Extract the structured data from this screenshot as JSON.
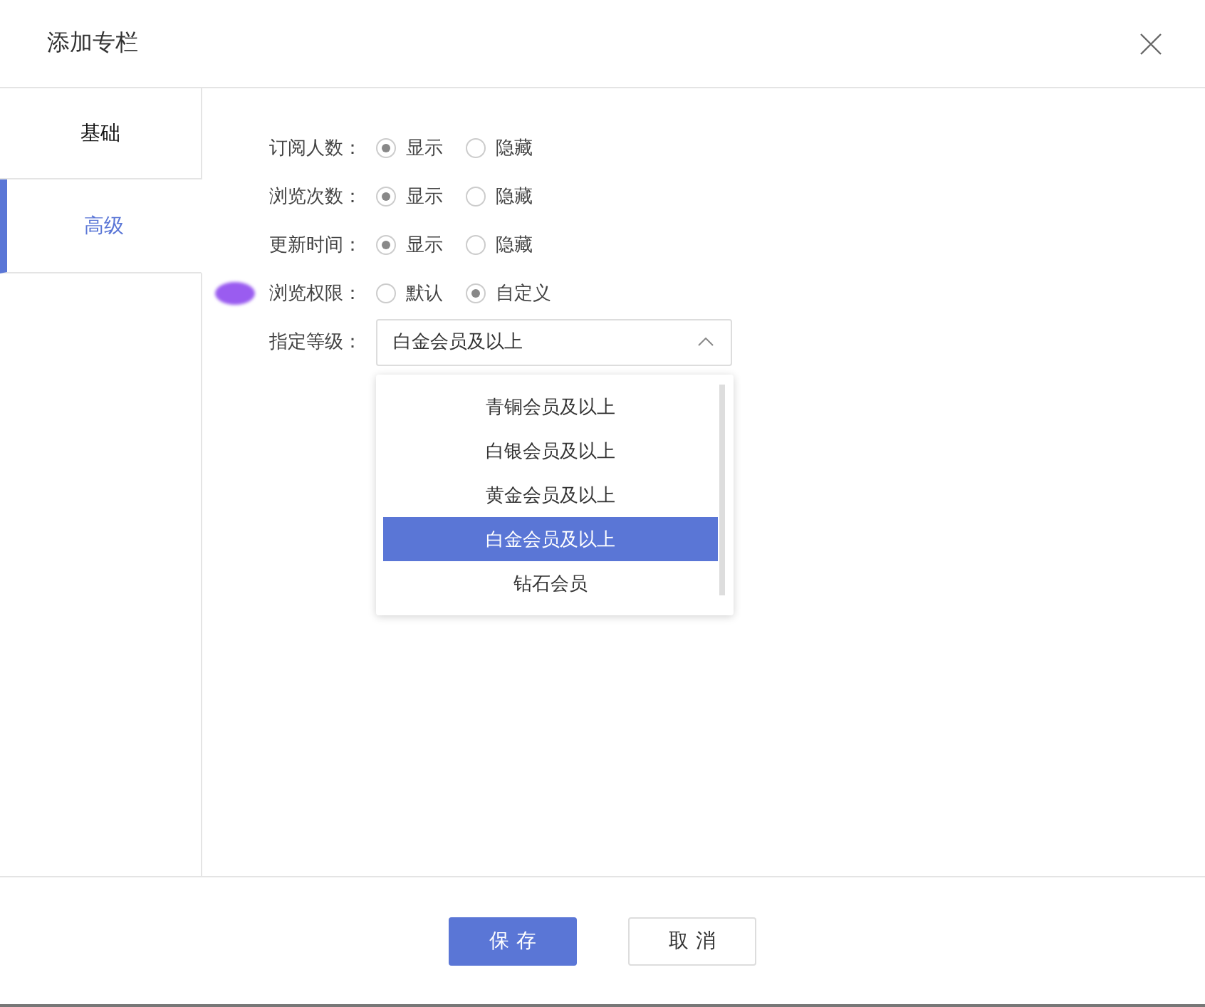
{
  "dialog": {
    "title": "添加专栏"
  },
  "tabs": [
    {
      "label": "基础",
      "selected": false
    },
    {
      "label": "高级",
      "selected": true
    }
  ],
  "fields": [
    {
      "kind": "radio",
      "label": "订阅人数：",
      "options": [
        {
          "label": "显示",
          "selected": true
        },
        {
          "label": "隐藏",
          "selected": false
        }
      ]
    },
    {
      "kind": "radio",
      "label": "浏览次数：",
      "options": [
        {
          "label": "显示",
          "selected": true
        },
        {
          "label": "隐藏",
          "selected": false
        }
      ]
    },
    {
      "kind": "radio",
      "label": "更新时间：",
      "options": [
        {
          "label": "显示",
          "selected": true
        },
        {
          "label": "隐藏",
          "selected": false
        }
      ]
    },
    {
      "kind": "radio",
      "label": "浏览权限：",
      "options": [
        {
          "label": "默认",
          "selected": false
        },
        {
          "label": "自定义",
          "selected": true
        }
      ]
    },
    {
      "kind": "select",
      "label": "指定等级：",
      "value": "白金会员及以上",
      "expanded": true,
      "options": [
        {
          "label": "青铜会员及以上",
          "selected": false
        },
        {
          "label": "白银会员及以上",
          "selected": false
        },
        {
          "label": "黄金会员及以上",
          "selected": false
        },
        {
          "label": "白金会员及以上",
          "selected": true
        },
        {
          "label": "钻石会员",
          "selected": false
        }
      ]
    }
  ],
  "buttons": [
    {
      "label": "保存",
      "kind": "primary"
    },
    {
      "label": "取消",
      "kind": "default"
    }
  ]
}
